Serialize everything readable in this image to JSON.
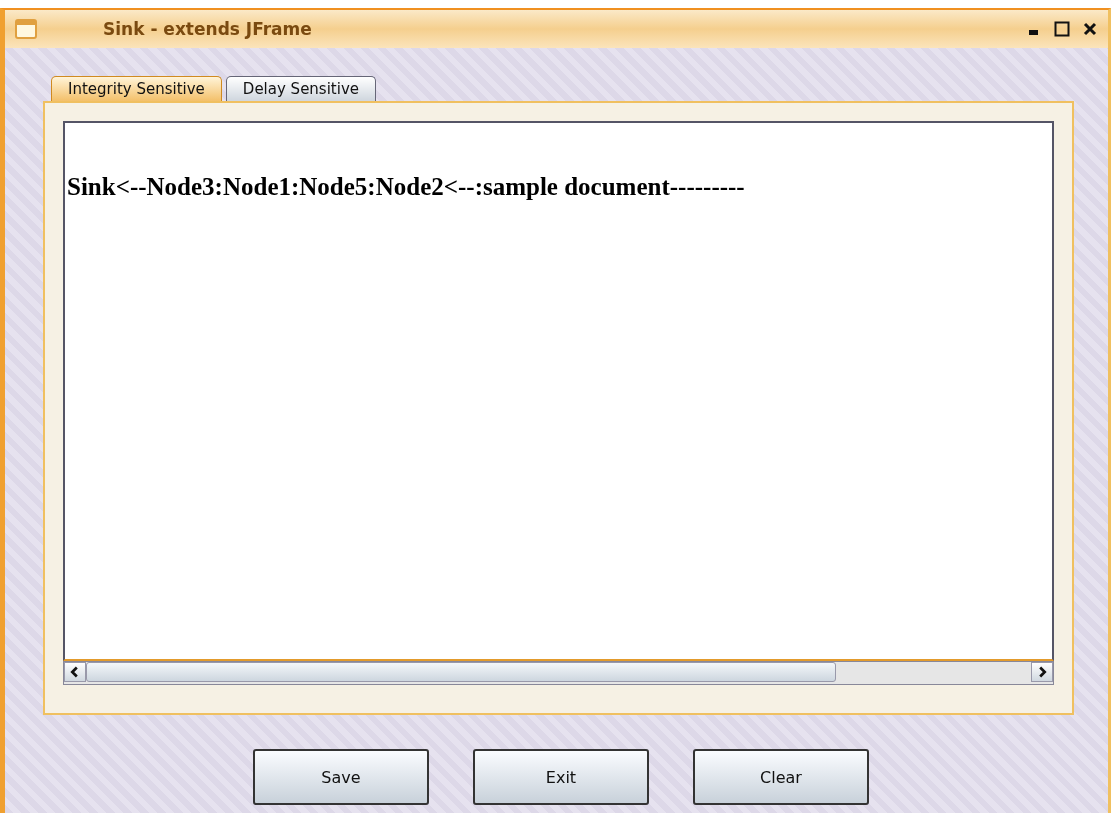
{
  "window": {
    "title": "Sink - extends JFrame"
  },
  "tabs": [
    {
      "label": "Integrity Sensitive",
      "selected": true
    },
    {
      "label": "Delay Sensitive",
      "selected": false
    }
  ],
  "text_area": {
    "value": "Sink<--Node3:Node1:Node5:Node2<--:sample document---------"
  },
  "buttons": [
    "Save",
    "Exit",
    "Clear"
  ]
}
